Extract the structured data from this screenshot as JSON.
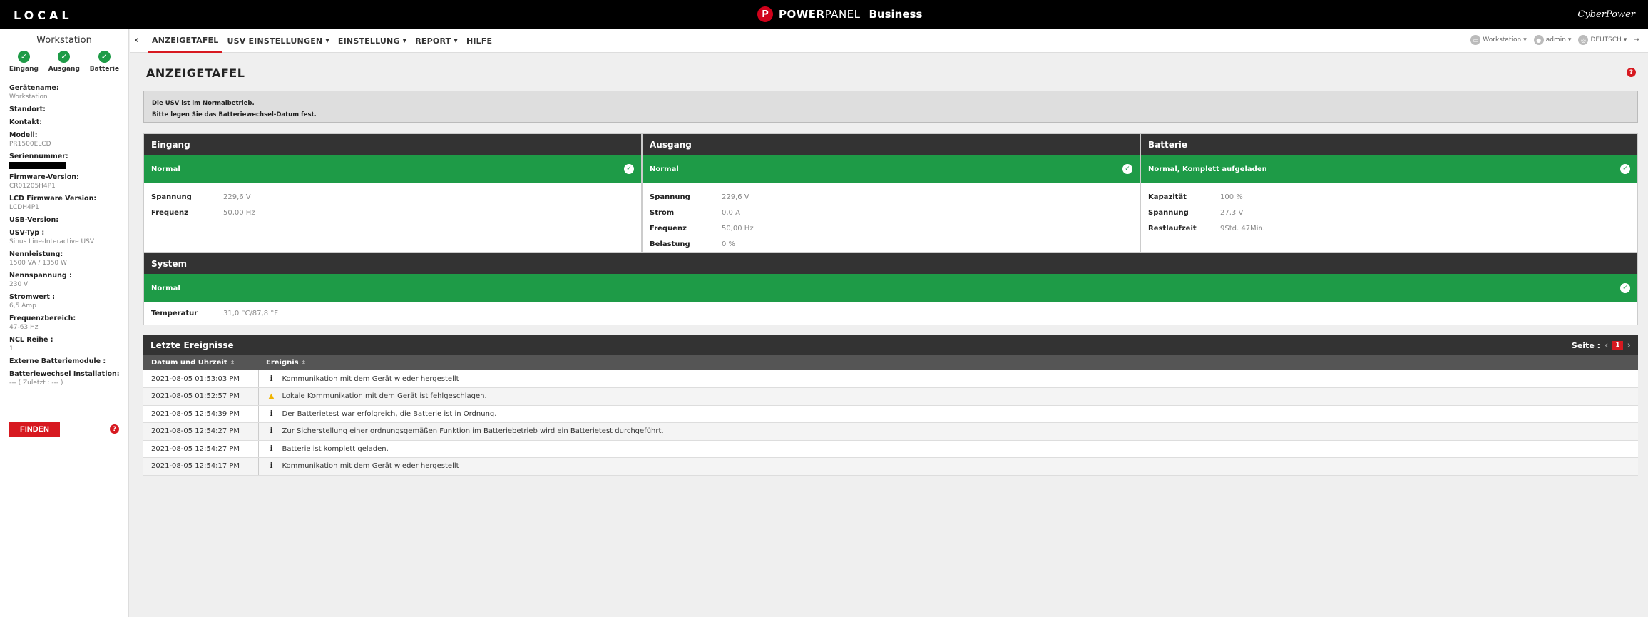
{
  "topbar": {
    "local_label": "LOCAL",
    "brand_logo": "P",
    "brand_power": "POWER",
    "brand_panel": "PANEL",
    "brand_business": "Business",
    "vendor": "CyberPower"
  },
  "sidebar": {
    "device_title": "Workstation",
    "statuses": [
      {
        "label": "Eingang",
        "icon": "check-icon"
      },
      {
        "label": "Ausgang",
        "icon": "check-icon"
      },
      {
        "label": "Batterie",
        "icon": "check-icon"
      }
    ],
    "info": {
      "geraetename": {
        "label": "Gerätename:",
        "value": "Workstation"
      },
      "standort": {
        "label": "Standort:",
        "value": ""
      },
      "kontakt": {
        "label": "Kontakt:",
        "value": ""
      },
      "modell": {
        "label": "Modell:",
        "value": "PR1500ELCD"
      },
      "seriennummer": {
        "label": "Seriennummer:",
        "value": ""
      },
      "firmware": {
        "label": "Firmware-Version:",
        "value": "CR01205H4P1"
      },
      "lcd_firmware": {
        "label": "LCD Firmware Version:",
        "value": "LCDH4P1"
      },
      "usb_version": {
        "label": "USB-Version:",
        "value": ""
      },
      "usv_typ": {
        "label": "USV-Typ :",
        "value": "Sinus Line-Interactive USV"
      },
      "nennleistung": {
        "label": "Nennleistung:",
        "value": "1500 VA / 1350 W"
      },
      "nennspannung": {
        "label": "Nennspannung :",
        "value": "230 V"
      },
      "stromwert": {
        "label": "Stromwert :",
        "value": "6,5 Amp"
      },
      "frequenzbereich": {
        "label": "Frequenzbereich:",
        "value": "47-63 Hz"
      },
      "ncl_reihe": {
        "label": "NCL Reihe :",
        "value": "1"
      },
      "externe_batt": {
        "label": "Externe Batteriemodule :",
        "value": ""
      },
      "battwechsel": {
        "label": "Batteriewechsel Installation:",
        "value": "--- ( Zuletzt : --- )"
      }
    },
    "find_button": "FINDEN",
    "help_glyph": "?"
  },
  "nav": {
    "back_glyph": "‹",
    "tabs": [
      {
        "label": "ANZEIGETAFEL",
        "has_menu": false
      },
      {
        "label": "USV EINSTELLUNGEN",
        "has_menu": true
      },
      {
        "label": "EINSTELLUNG",
        "has_menu": true
      },
      {
        "label": "REPORT",
        "has_menu": true
      },
      {
        "label": "HILFE",
        "has_menu": false
      }
    ],
    "right": {
      "device": "Workstation",
      "user": "admin",
      "language": "DEUTSCH"
    }
  },
  "main": {
    "title": "ANZEIGETAFEL",
    "help_glyph": "?",
    "notice_line1": "Die USV ist im Normalbetrieb.",
    "notice_line2": "Bitte legen Sie das Batteriewechsel-Datum fest."
  },
  "panels": {
    "eingang": {
      "title": "Eingang",
      "status": "Normal",
      "rows": [
        {
          "k": "Spannung",
          "v": "229,6 V"
        },
        {
          "k": "Frequenz",
          "v": "50,00 Hz"
        }
      ]
    },
    "ausgang": {
      "title": "Ausgang",
      "status": "Normal",
      "rows": [
        {
          "k": "Spannung",
          "v": "229,6 V"
        },
        {
          "k": "Strom",
          "v": "0,0 A"
        },
        {
          "k": "Frequenz",
          "v": "50,00 Hz"
        },
        {
          "k": "Belastung",
          "v": "0 %"
        }
      ]
    },
    "batterie": {
      "title": "Batterie",
      "status": "Normal, Komplett aufgeladen",
      "rows": [
        {
          "k": "Kapazität",
          "v": "100 %"
        },
        {
          "k": "Spannung",
          "v": "27,3 V"
        },
        {
          "k": "Restlaufzeit",
          "v": "9Std. 47Min."
        }
      ]
    },
    "system": {
      "title": "System",
      "status": "Normal",
      "rows": [
        {
          "k": "Temperatur",
          "v": "31,0 °C/87,8 °F"
        }
      ]
    }
  },
  "events": {
    "title": "Letzte Ereignisse",
    "page_label": "Seite :",
    "page_current": "1",
    "col_date": "Datum und Uhrzeit",
    "col_event": "Ereignis",
    "rows": [
      {
        "date": "2021-08-05 01:53:03 PM",
        "icon": "info",
        "text": "Kommunikation mit dem Gerät wieder hergestellt"
      },
      {
        "date": "2021-08-05 01:52:57 PM",
        "icon": "warning",
        "text": "Lokale Kommunikation mit dem Gerät ist fehlgeschlagen."
      },
      {
        "date": "2021-08-05 12:54:39 PM",
        "icon": "info",
        "text": "Der Batterietest war erfolgreich, die Batterie ist in Ordnung."
      },
      {
        "date": "2021-08-05 12:54:27 PM",
        "icon": "info",
        "text": "Zur Sicherstellung einer ordnungsgemäßen Funktion im Batteriebetrieb wird ein Batterietest durchgeführt."
      },
      {
        "date": "2021-08-05 12:54:27 PM",
        "icon": "info",
        "text": "Batterie ist komplett geladen."
      },
      {
        "date": "2021-08-05 12:54:17 PM",
        "icon": "info",
        "text": "Kommunikation mit dem Gerät wieder hergestellt"
      }
    ]
  },
  "colors": {
    "accent_red": "#d71920",
    "status_green": "#1e9b47",
    "header_dark": "#333333"
  }
}
